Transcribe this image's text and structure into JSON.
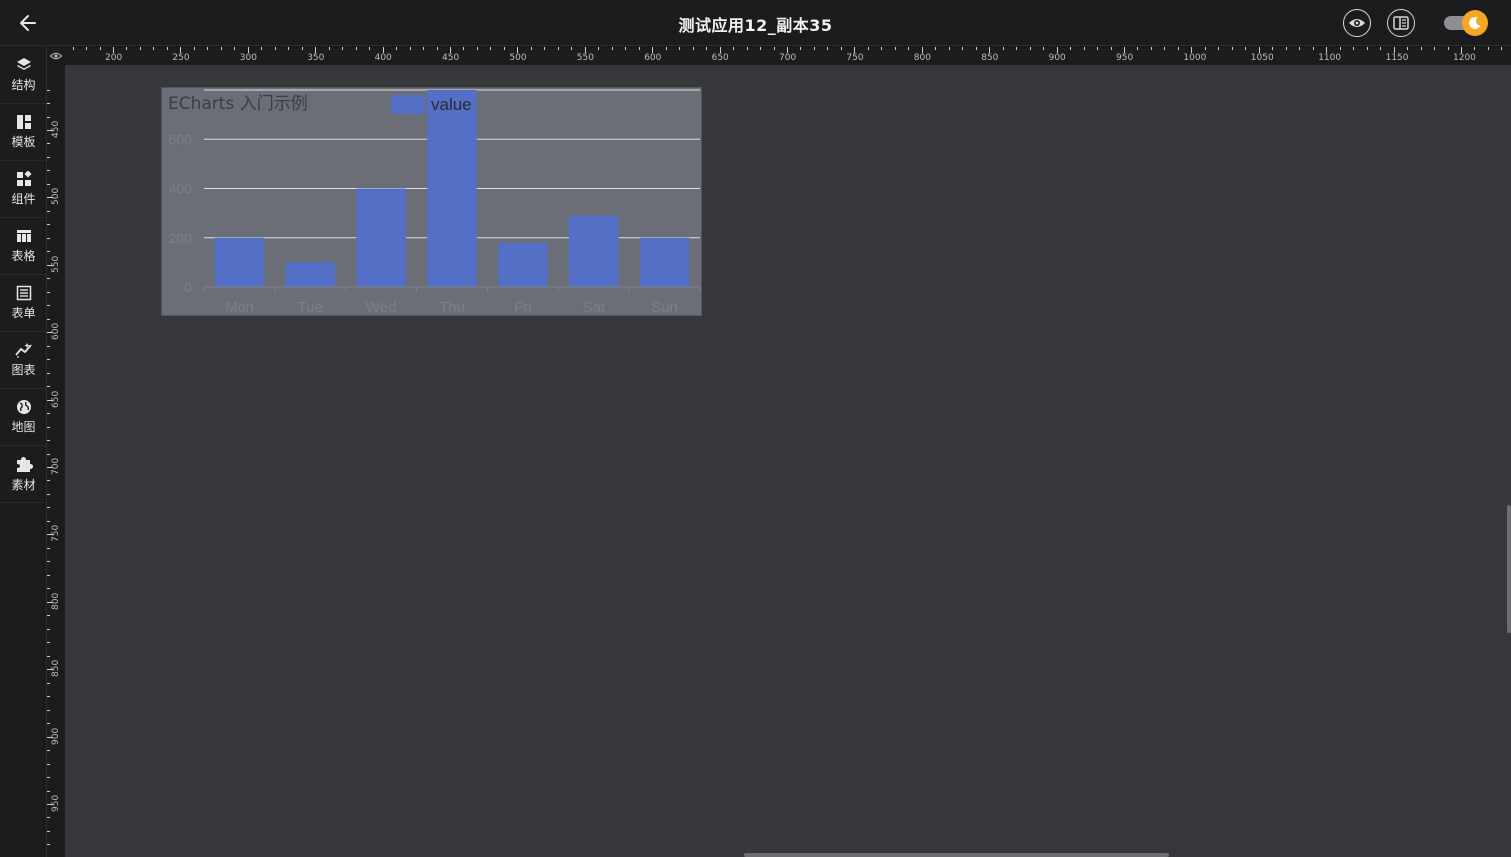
{
  "header": {
    "title": "测试应用12_副本35"
  },
  "sidebar": {
    "items": [
      {
        "label": "结构",
        "icon": "layers-icon"
      },
      {
        "label": "模板",
        "icon": "template-icon"
      },
      {
        "label": "组件",
        "icon": "components-icon"
      },
      {
        "label": "表格",
        "icon": "table-icon"
      },
      {
        "label": "表单",
        "icon": "form-icon"
      },
      {
        "label": "图表",
        "icon": "chart-icon"
      },
      {
        "label": "地图",
        "icon": "globe-icon"
      },
      {
        "label": "素材",
        "icon": "puzzle-icon"
      }
    ]
  },
  "rulers": {
    "top_labels": [
      "200",
      "250",
      "300",
      "350",
      "400",
      "450",
      "500",
      "550",
      "600",
      "650",
      "700",
      "750",
      "800",
      "850",
      "900",
      "950",
      "1000",
      "1050",
      "1100",
      "1150",
      "1200"
    ],
    "left_labels": [
      "450",
      "500",
      "550",
      "600",
      "650",
      "700",
      "750",
      "800",
      "850",
      "900",
      "950"
    ]
  },
  "colors": {
    "bar": "#5470c6",
    "canvas": "#36373a",
    "chart_bg": "#6b6d77",
    "toggle_accent": "#f5a623"
  },
  "chart_data": {
    "type": "bar",
    "title": "ECharts 入门示例",
    "categories": [
      "Mon",
      "Tue",
      "Wed",
      "Thu",
      "Fri",
      "Sat",
      "Sun"
    ],
    "series": [
      {
        "name": "value",
        "values": [
          200,
          100,
          400,
          800,
          180,
          290,
          200
        ]
      }
    ],
    "ylim": [
      0,
      800
    ],
    "yticks": [
      0,
      200,
      400,
      600
    ],
    "grid": true,
    "legend": "top-center"
  }
}
